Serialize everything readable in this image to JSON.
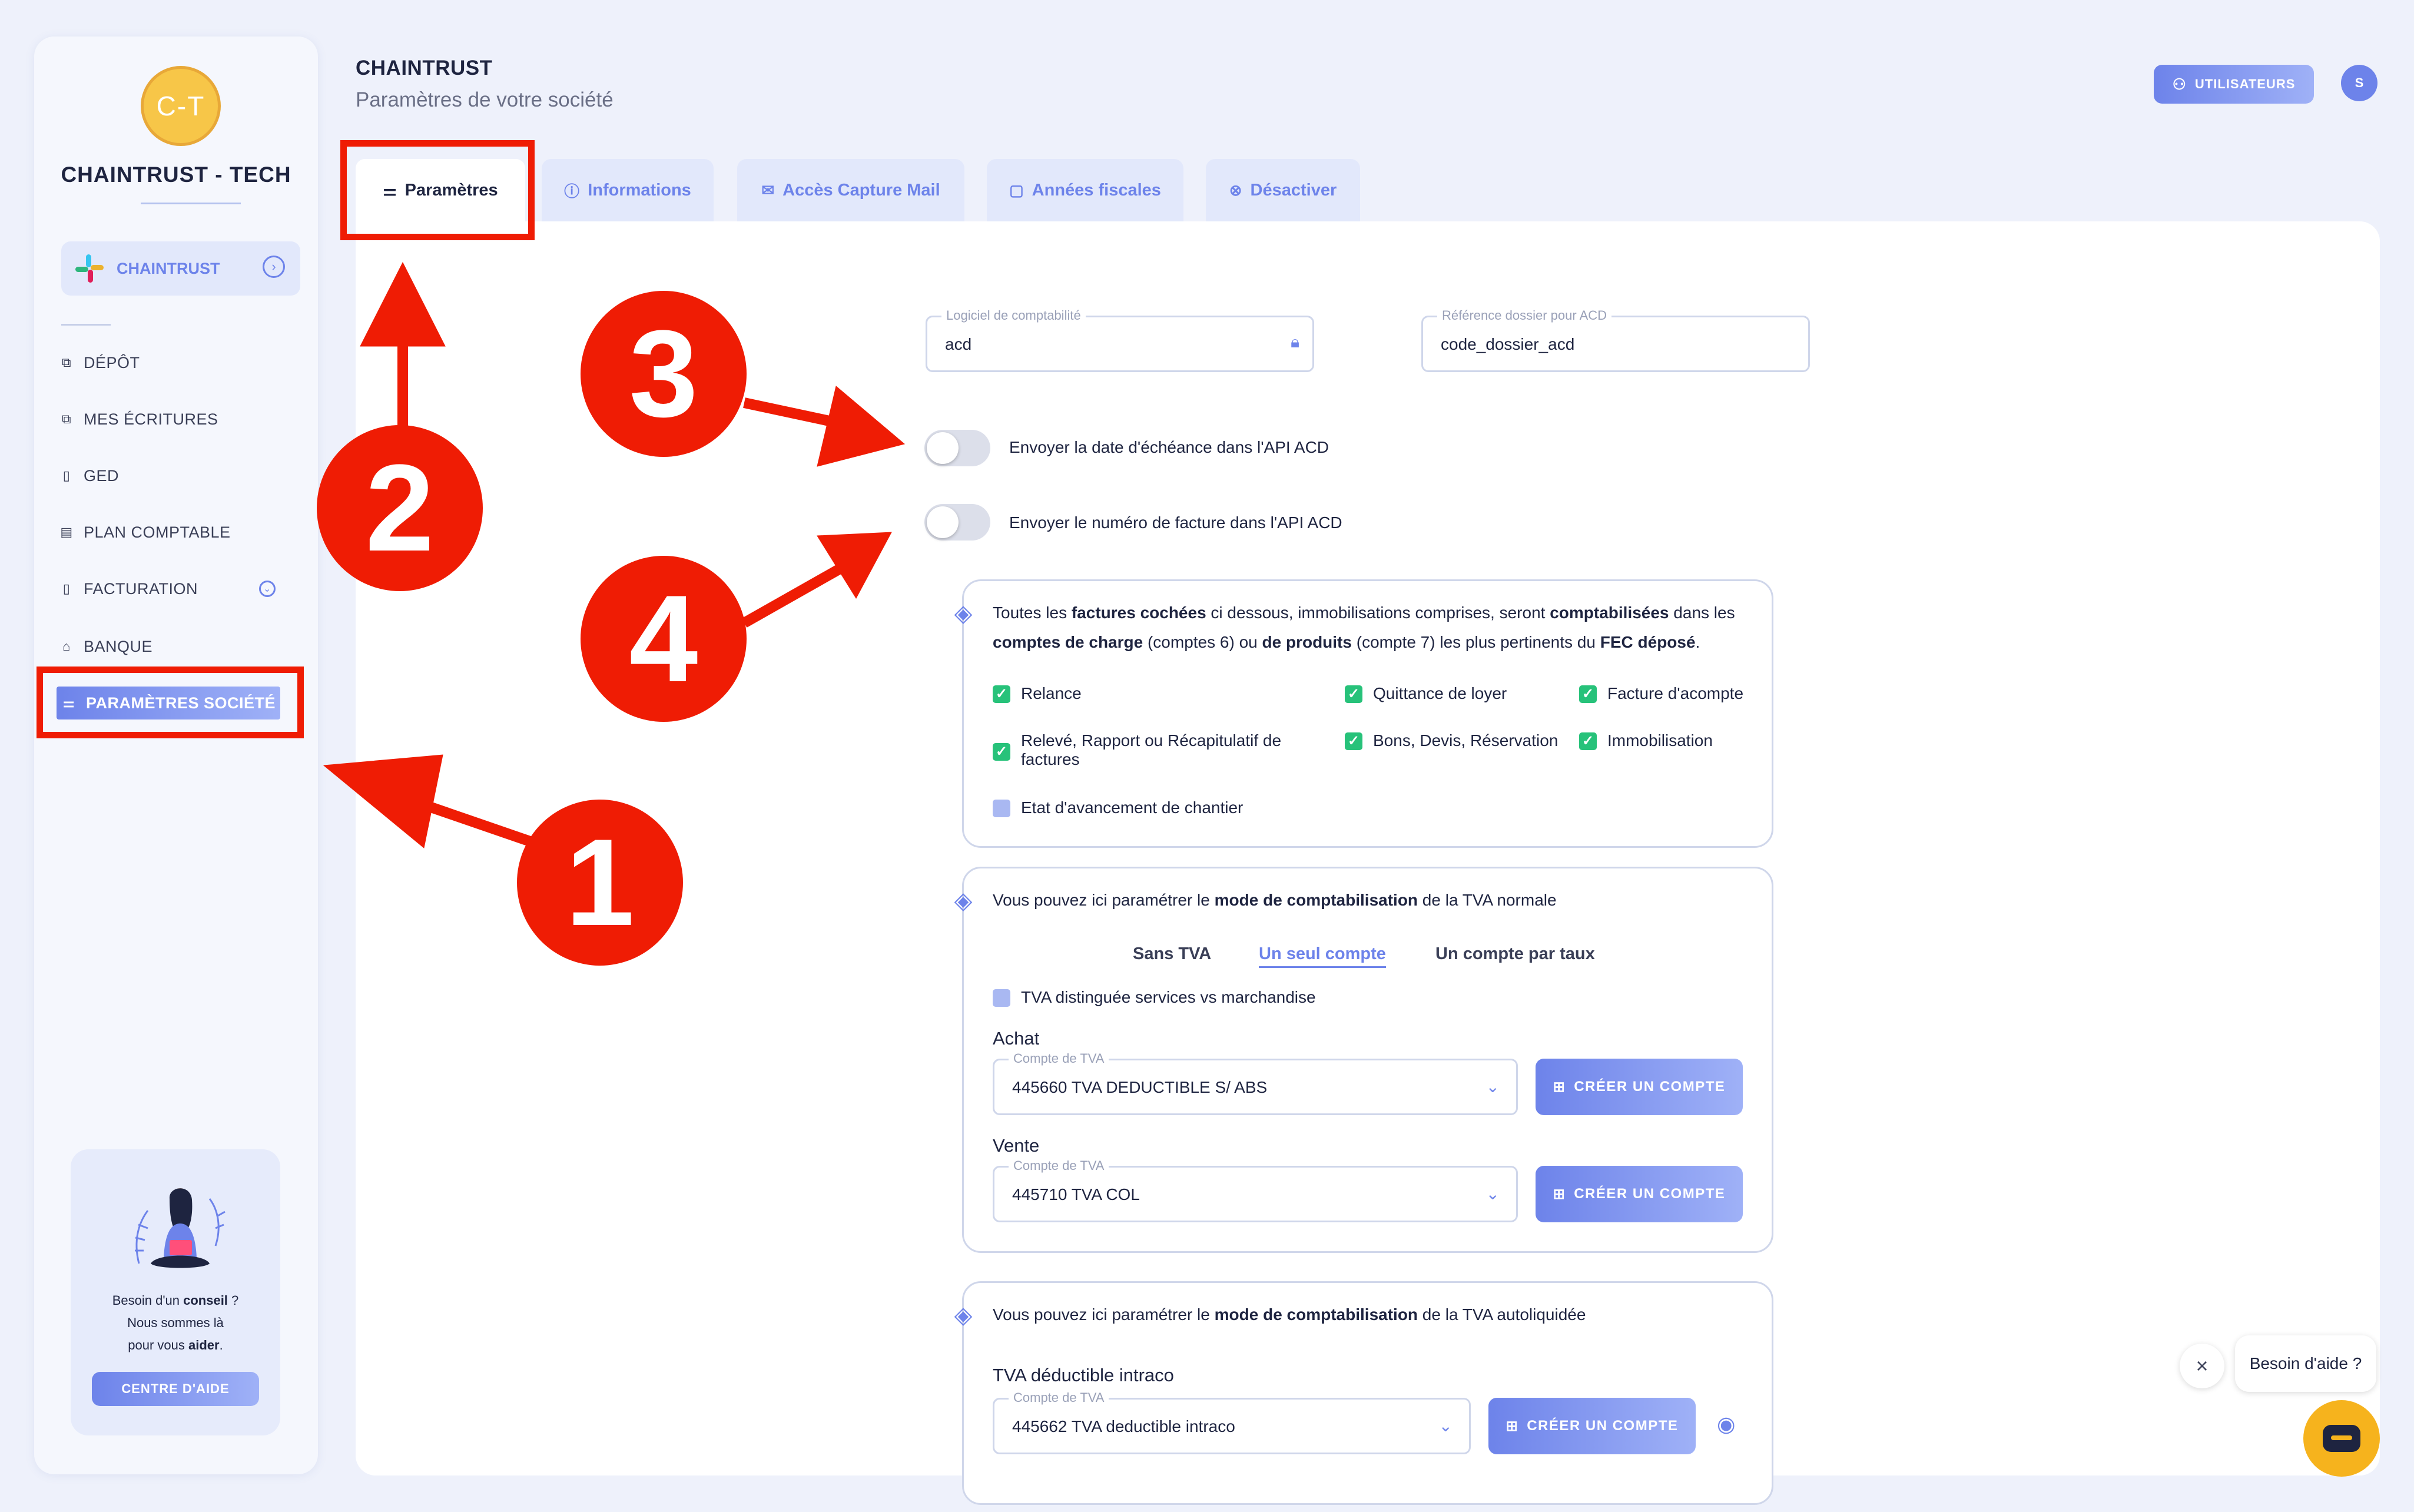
{
  "sidebar": {
    "avatar_initials": "C-T",
    "company_name": "CHAINTRUST - TECH",
    "org_selector": {
      "label": "CHAINTRUST"
    },
    "items": [
      {
        "label": "DÉPÔT",
        "icon": "upload-icon"
      },
      {
        "label": "MES ÉCRITURES",
        "icon": "entries-icon"
      },
      {
        "label": "GED",
        "icon": "document-icon"
      },
      {
        "label": "PLAN COMPTABLE",
        "icon": "ledger-icon"
      },
      {
        "label": "FACTURATION",
        "icon": "invoice-icon"
      },
      {
        "label": "BANQUE",
        "icon": "bank-icon"
      },
      {
        "label": "PARAMÈTRES SOCIÉTÉ",
        "icon": "sliders-icon",
        "active": true
      }
    ],
    "help": {
      "line1_plain": "Besoin d'un ",
      "line1_bold": "conseil",
      "line1_end": " ?",
      "line2": "Nous sommes là",
      "line3_plain": "pour vous ",
      "line3_bold": "aider",
      "line3_end": ".",
      "button": "CENTRE D'AIDE"
    }
  },
  "header": {
    "title": "CHAINTRUST",
    "subtitle": "Paramètres de votre société",
    "users_button": "UTILISATEURS",
    "user_initial": "S"
  },
  "tabs": [
    {
      "label": "Paramètres",
      "active": true
    },
    {
      "label": "Informations"
    },
    {
      "label": "Accès Capture Mail"
    },
    {
      "label": "Années fiscales"
    },
    {
      "label": "Désactiver"
    }
  ],
  "settings": {
    "software": {
      "label": "Logiciel de comptabilité",
      "value": "acd"
    },
    "acd_ref": {
      "label": "Référence dossier pour ACD",
      "value": "code_dossier_acd"
    },
    "toggle_due_date": {
      "label": "Envoyer la date d'échéance dans l'API ACD",
      "on": false
    },
    "toggle_invoice_number": {
      "label": "Envoyer le numéro de facture dans l'API ACD",
      "on": false
    }
  },
  "invoices_box": {
    "p1": "Toutes les ",
    "b1": "factures cochées",
    "p2": " ci dessous, immobilisations comprises, seront ",
    "b2": "comptabilisées",
    "p3": " dans les",
    "b3": "comptes de charge",
    "p4": " (comptes 6) ou ",
    "b4": "de produits",
    "p5": " (compte 7) les plus pertinents du ",
    "b5": "FEC déposé",
    "p6": ".",
    "checks": [
      {
        "label": "Relance",
        "checked": true
      },
      {
        "label": "Quittance de loyer",
        "checked": true
      },
      {
        "label": "Facture d'acompte",
        "checked": true
      },
      {
        "label": "Relevé, Rapport ou Récapitulatif de factures",
        "checked": true
      },
      {
        "label": "Bons, Devis, Réservation",
        "checked": true
      },
      {
        "label": "Immobilisation",
        "checked": true
      },
      {
        "label": "Etat d'avancement de chantier",
        "checked": false
      }
    ]
  },
  "vat_box": {
    "p1": "Vous pouvez ici paramétrer le ",
    "b1": "mode de comptabilisation",
    "p2": " de la TVA normale",
    "modes": [
      "Sans TVA",
      "Un seul compte",
      "Un compte par taux"
    ],
    "active_mode": "Un seul compte",
    "distinguish_label": "TVA distinguée services vs marchandise",
    "purchase": {
      "title": "Achat",
      "field_label": "Compte de TVA",
      "value": "445660 TVA DEDUCTIBLE S/ ABS"
    },
    "sale": {
      "title": "Vente",
      "field_label": "Compte de TVA",
      "value": "445710 TVA COL"
    },
    "create_button": "CRÉER UN COMPTE"
  },
  "reverse_box": {
    "p1": "Vous pouvez ici paramétrer le ",
    "b1": "mode de comptabilisation",
    "p2": " de la TVA autoliquidée",
    "section_title": "TVA déductible intraco",
    "field_label": "Compte de TVA",
    "value": "445662 TVA deductible intraco",
    "create_button": "CRÉER UN COMPTE"
  },
  "chat": {
    "tooltip": "Besoin d'aide ?"
  },
  "annotations": [
    "1",
    "2",
    "3",
    "4"
  ],
  "colors": {
    "accent": "#6d83ea",
    "annotation_red": "#ef1c04",
    "check_green": "#27c27a",
    "chat_yellow": "#f6b31d"
  }
}
